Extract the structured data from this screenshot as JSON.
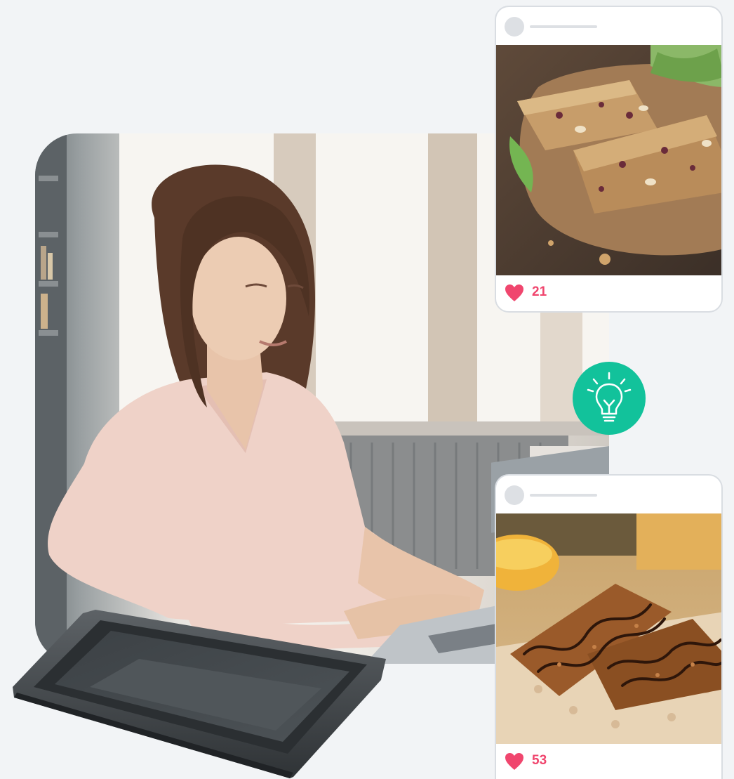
{
  "posts": [
    {
      "likes": "21",
      "icon": "heart-icon",
      "photo": "granola-bars-on-board"
    },
    {
      "likes": "53",
      "icon": "heart-icon",
      "photo": "chocolate-granola-bars"
    }
  ],
  "idea": {
    "icon": "lightbulb-icon"
  },
  "colors": {
    "background": "#f2f4f6",
    "like": "#f0466e",
    "idea": "#12c29b",
    "card_border": "#d9dde2"
  }
}
